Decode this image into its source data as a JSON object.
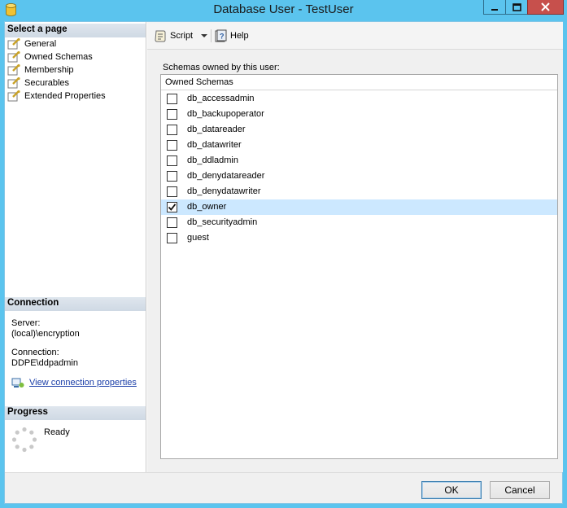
{
  "window": {
    "title": "Database User - TestUser"
  },
  "left": {
    "select_page_header": "Select a page",
    "pages": [
      {
        "label": "General"
      },
      {
        "label": "Owned Schemas"
      },
      {
        "label": "Membership"
      },
      {
        "label": "Securables"
      },
      {
        "label": "Extended Properties"
      }
    ],
    "connection_header": "Connection",
    "server_label": "Server:",
    "server_value": "(local)\\encryption",
    "connection_label": "Connection:",
    "connection_value": "DDPE\\ddpadmin",
    "view_conn_props": "View connection properties",
    "progress_header": "Progress",
    "progress_status": "Ready"
  },
  "toolbar": {
    "script_label": "Script",
    "help_label": "Help"
  },
  "main": {
    "schemas_label": "Schemas owned by this user:",
    "column_header": "Owned Schemas",
    "schemas": [
      {
        "name": "db_accessadmin",
        "checked": false
      },
      {
        "name": "db_backupoperator",
        "checked": false
      },
      {
        "name": "db_datareader",
        "checked": false
      },
      {
        "name": "db_datawriter",
        "checked": false
      },
      {
        "name": "db_ddladmin",
        "checked": false
      },
      {
        "name": "db_denydatareader",
        "checked": false
      },
      {
        "name": "db_denydatawriter",
        "checked": false
      },
      {
        "name": "db_owner",
        "checked": true
      },
      {
        "name": "db_securityadmin",
        "checked": false
      },
      {
        "name": "guest",
        "checked": false
      }
    ],
    "selected_row": "db_owner"
  },
  "footer": {
    "ok_label": "OK",
    "cancel_label": "Cancel"
  },
  "colors": {
    "titlebar": "#5bc4ee",
    "close_button": "#c7504c",
    "selection": "#cce8ff",
    "link": "#1a3ea8"
  }
}
